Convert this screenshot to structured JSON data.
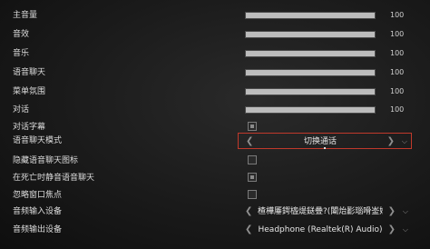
{
  "sliders": [
    {
      "label": "主音量",
      "value": "100",
      "fill": 1.0
    },
    {
      "label": "音效",
      "value": "100",
      "fill": 1.0
    },
    {
      "label": "音乐",
      "value": "100",
      "fill": 1.0
    },
    {
      "label": "语音聊天",
      "value": "100",
      "fill": 1.0
    },
    {
      "label": "菜单氛围",
      "value": "100",
      "fill": 1.0
    },
    {
      "label": "对话",
      "value": "100",
      "fill": 1.0
    }
  ],
  "dialogue_subtitles": {
    "label": "对话字幕",
    "checked": true
  },
  "voice_chat_mode": {
    "label": "语音聊天模式",
    "value": "切换通话"
  },
  "hide_voice_icon": {
    "label": "隐藏语音聊天图标",
    "checked": false
  },
  "mute_voice_dead": {
    "label": "在死亡时静音语音聊天",
    "checked": true
  },
  "ignore_focus": {
    "label": "忽略窗口焦点",
    "checked": false
  },
  "input_device": {
    "label": "音频输入设备",
    "value": "楂樺厜鍔橀煶鎹曡?(闈炲彲瑙嗗崟姣嶅枒閬撳)"
  },
  "output_device": {
    "label": "音频输出设备",
    "value": "Headphone (Realtek(R) Audio)"
  },
  "colors": {
    "highlight_border": "#c0392b",
    "slider_fill": "#bcbcbc"
  }
}
